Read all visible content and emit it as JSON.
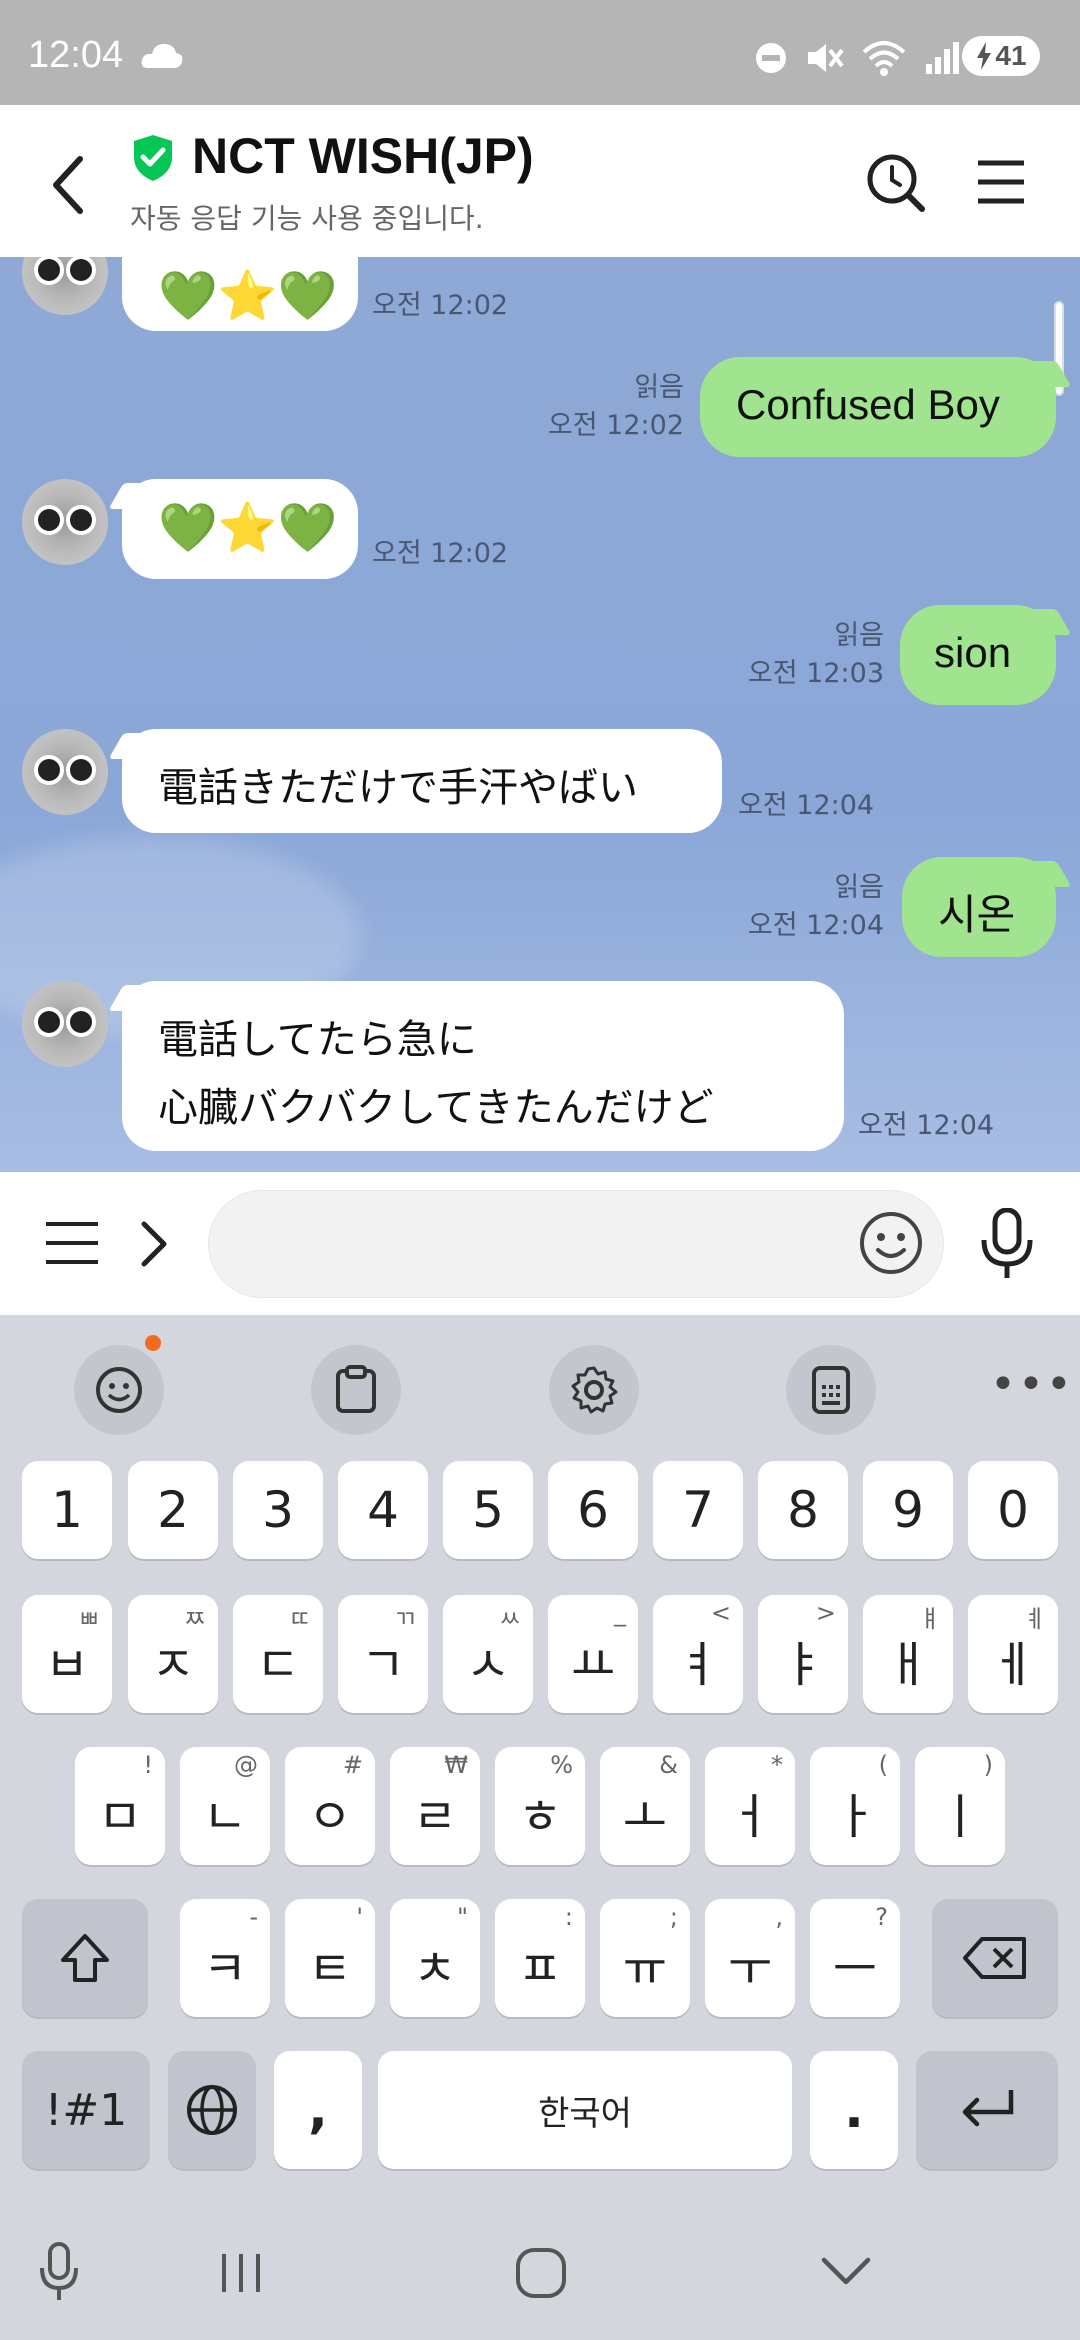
{
  "status_bar": {
    "time": "12:04",
    "battery": "41",
    "signal_label": "5"
  },
  "header": {
    "title": "NCT WISH(JP)",
    "subtitle": "자동 응답 기능 사용 중입니다."
  },
  "messages": [
    {
      "side": "in",
      "text": "💚⭐💚",
      "time": "오전 12:02"
    },
    {
      "side": "out",
      "text": "Confused Boy",
      "read": "읽음",
      "time": "오전 12:02"
    },
    {
      "side": "in",
      "text": "💚⭐💚",
      "time": "오전 12:02"
    },
    {
      "side": "out",
      "text": "sion",
      "read": "읽음",
      "time": "오전 12:03"
    },
    {
      "side": "in",
      "text": "電話きただけで手汗やばい",
      "time": "오전 12:04"
    },
    {
      "side": "out",
      "text": "시온",
      "read": "읽음",
      "time": "오전 12:04"
    },
    {
      "side": "in",
      "text_lines": [
        "電話してたら急に",
        "心臓バクバクしてきたんだけど"
      ],
      "time": "오전 12:04"
    }
  ],
  "input": {
    "value": "",
    "placeholder": ""
  },
  "keyboard": {
    "number_row": [
      "1",
      "2",
      "3",
      "4",
      "5",
      "6",
      "7",
      "8",
      "9",
      "0"
    ],
    "row1": [
      {
        "main": "ㅂ",
        "sub": "ㅃ"
      },
      {
        "main": "ㅈ",
        "sub": "ㅉ"
      },
      {
        "main": "ㄷ",
        "sub": "ㄸ"
      },
      {
        "main": "ㄱ",
        "sub": "ㄲ"
      },
      {
        "main": "ㅅ",
        "sub": "ㅆ"
      },
      {
        "main": "ㅛ",
        "sub": "_"
      },
      {
        "main": "ㅕ",
        "sub": "<"
      },
      {
        "main": "ㅑ",
        "sub": ">"
      },
      {
        "main": "ㅐ",
        "sub": "ㅒ"
      },
      {
        "main": "ㅔ",
        "sub": "ㅖ"
      }
    ],
    "row2": [
      {
        "main": "ㅁ",
        "sub": "!"
      },
      {
        "main": "ㄴ",
        "sub": "@"
      },
      {
        "main": "ㅇ",
        "sub": "#"
      },
      {
        "main": "ㄹ",
        "sub": "₩"
      },
      {
        "main": "ㅎ",
        "sub": "%"
      },
      {
        "main": "ㅗ",
        "sub": "&"
      },
      {
        "main": "ㅓ",
        "sub": "*"
      },
      {
        "main": "ㅏ",
        "sub": "("
      },
      {
        "main": "ㅣ",
        "sub": ")"
      }
    ],
    "row3": [
      {
        "main": "ㅋ",
        "sub": "-"
      },
      {
        "main": "ㅌ",
        "sub": "'"
      },
      {
        "main": "ㅊ",
        "sub": "\""
      },
      {
        "main": "ㅍ",
        "sub": ":"
      },
      {
        "main": "ㅠ",
        "sub": ";"
      },
      {
        "main": "ㅜ",
        "sub": ","
      },
      {
        "main": "ㅡ",
        "sub": "?"
      }
    ],
    "symbols_label": "!#1",
    "comma": ",",
    "space_label": "한국어",
    "period": "."
  },
  "colors": {
    "chat_bg": "#8aa7d8",
    "out_bubble": "#a0e48f",
    "shield_green": "#06c755",
    "notif_dot": "#f26b1f"
  }
}
